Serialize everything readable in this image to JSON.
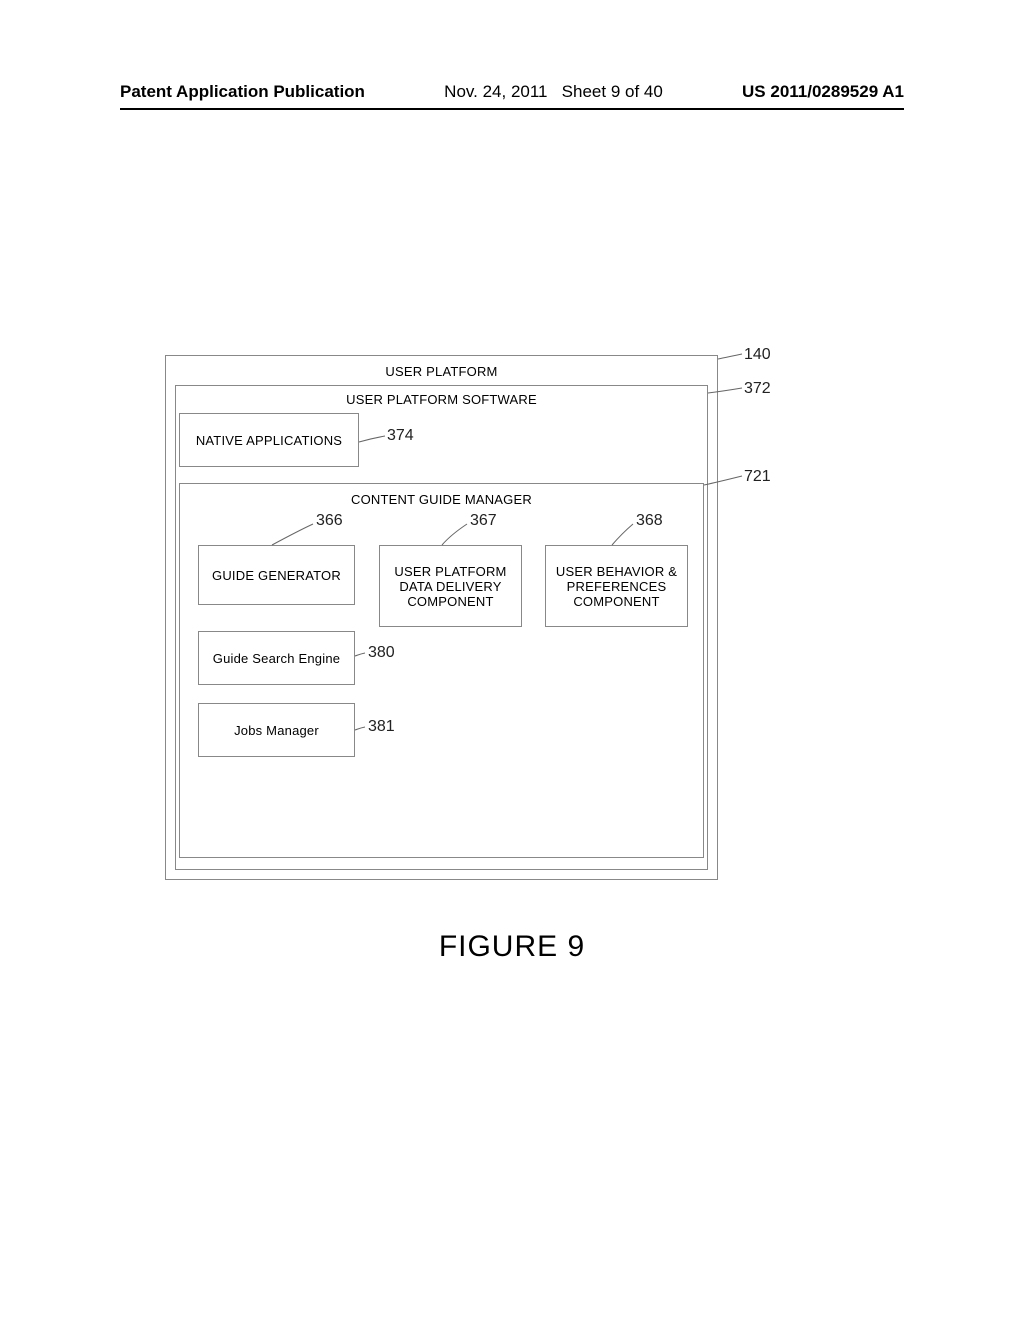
{
  "header": {
    "left": "Patent Application Publication",
    "date": "Nov. 24, 2011",
    "sheet": "Sheet 9 of 40",
    "pubno": "US 2011/0289529 A1"
  },
  "figure_caption": "FIGURE 9",
  "boxes": {
    "user_platform": "USER PLATFORM",
    "software": "USER PLATFORM SOFTWARE",
    "native_apps": "NATIVE APPLICATIONS",
    "content_guide_manager": "CONTENT GUIDE MANAGER",
    "guide_generator": "GUIDE GENERATOR",
    "data_delivery": "USER PLATFORM DATA DELIVERY COMPONENT",
    "behavior_prefs": "USER BEHAVIOR & PREFERENCES COMPONENT",
    "guide_search_engine": "Guide Search Engine",
    "jobs_manager": "Jobs Manager"
  },
  "refs": {
    "r140": "140",
    "r372": "372",
    "r374": "374",
    "r721": "721",
    "r366": "366",
    "r367": "367",
    "r368": "368",
    "r380": "380",
    "r381": "381"
  }
}
